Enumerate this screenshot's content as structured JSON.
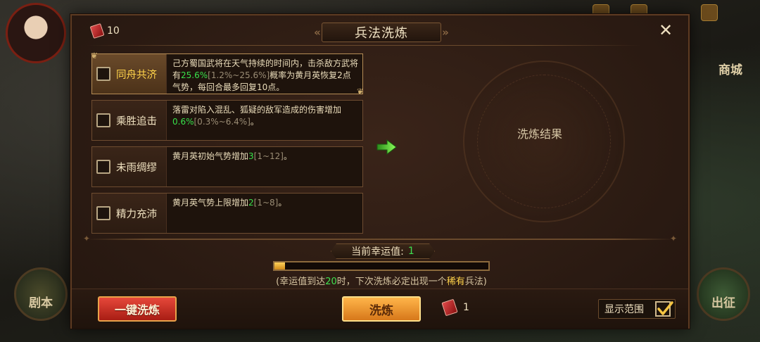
{
  "background": {
    "left_button_label": "剧本",
    "right_button_label": "出征",
    "shop_label": "商城"
  },
  "header": {
    "title": "兵法洗炼",
    "scroll_count": "10",
    "close_icon": "close-icon"
  },
  "skills": [
    {
      "name": "同舟共济",
      "selected": true,
      "desc_pre": "己方蜀国武将在天气持续的时间内，击杀敌方武将有",
      "highlight": "25.6%",
      "range": "[1.2%~25.6%]",
      "desc_post": "概率为黄月英恢复2点气势，每回合最多回复10点。"
    },
    {
      "name": "乘胜追击",
      "selected": false,
      "desc_pre": "落雷对陷入混乱、狐疑的敌军造成的伤害增加",
      "highlight": "0.6%",
      "range": "[0.3%~6.4%]",
      "desc_post": "。"
    },
    {
      "name": "未雨绸缪",
      "selected": false,
      "desc_pre": "黄月英初始气势增加",
      "highlight": "3",
      "range": "[1~12]",
      "desc_post": "。"
    },
    {
      "name": "精力充沛",
      "selected": false,
      "desc_pre": "黄月英气势上限增加",
      "highlight": "2",
      "range": "[1~8]",
      "desc_post": "。"
    }
  ],
  "result": {
    "label": "洗炼结果"
  },
  "luck": {
    "label": "当前幸运值:",
    "value": "1",
    "progress_fraction": 0.05,
    "tip_pre": "(幸运值到达",
    "tip_num": "20",
    "tip_mid": "时，下次洗炼必定出现一个",
    "tip_rare": "稀有",
    "tip_post": "兵法)"
  },
  "actions": {
    "one_click_label": "一键洗炼",
    "refine_label": "洗炼",
    "cost_count": "1",
    "show_range_label": "显示范围",
    "show_range_checked": true
  },
  "colors": {
    "highlight_green": "#38e04a",
    "selected_name_gold": "#ffd34a",
    "red_button": "#c8301f",
    "gold_button": "#f0a030"
  }
}
